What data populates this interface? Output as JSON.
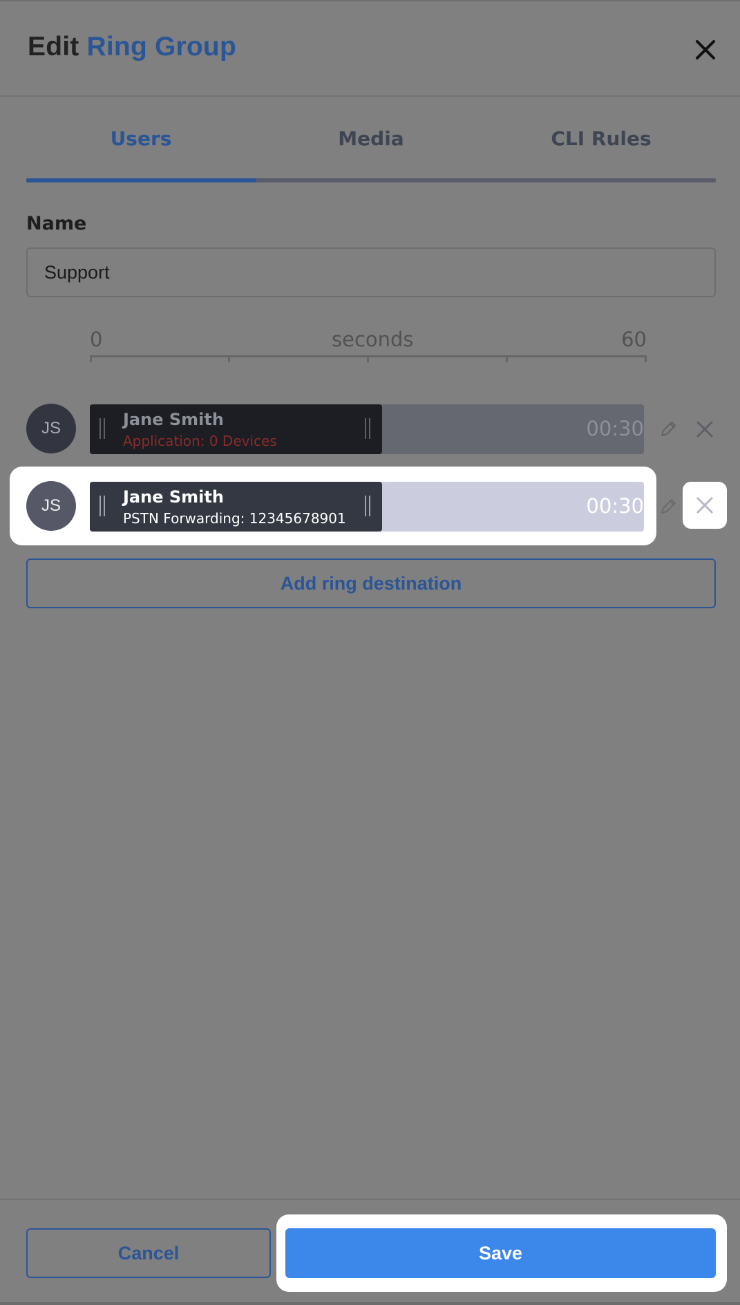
{
  "header": {
    "title_prefix": "Edit",
    "title_accent": "Ring Group",
    "close_icon": "close-icon"
  },
  "tabs": [
    {
      "label": "Users",
      "active": true
    },
    {
      "label": "Media",
      "active": false
    },
    {
      "label": "CLI Rules",
      "active": false
    }
  ],
  "form": {
    "name_label": "Name",
    "name_value": "Support"
  },
  "timeline": {
    "min_label": "0",
    "unit_label": "seconds",
    "max_label": "60"
  },
  "destinations": [
    {
      "initials": "JS",
      "name": "Jane Smith",
      "detail": "Application: 0 Devices",
      "duration": "00:30",
      "dimmed": true
    },
    {
      "initials": "JS",
      "name": "Jane Smith",
      "detail": "PSTN Forwarding: 12345678901",
      "duration": "00:30",
      "dimmed": false
    }
  ],
  "actions": {
    "add_destination": "Add ring destination",
    "cancel": "Cancel",
    "save": "Save"
  },
  "colors": {
    "accent": "#2a5596",
    "save": "#3c87ea",
    "overlay": "#808080"
  }
}
